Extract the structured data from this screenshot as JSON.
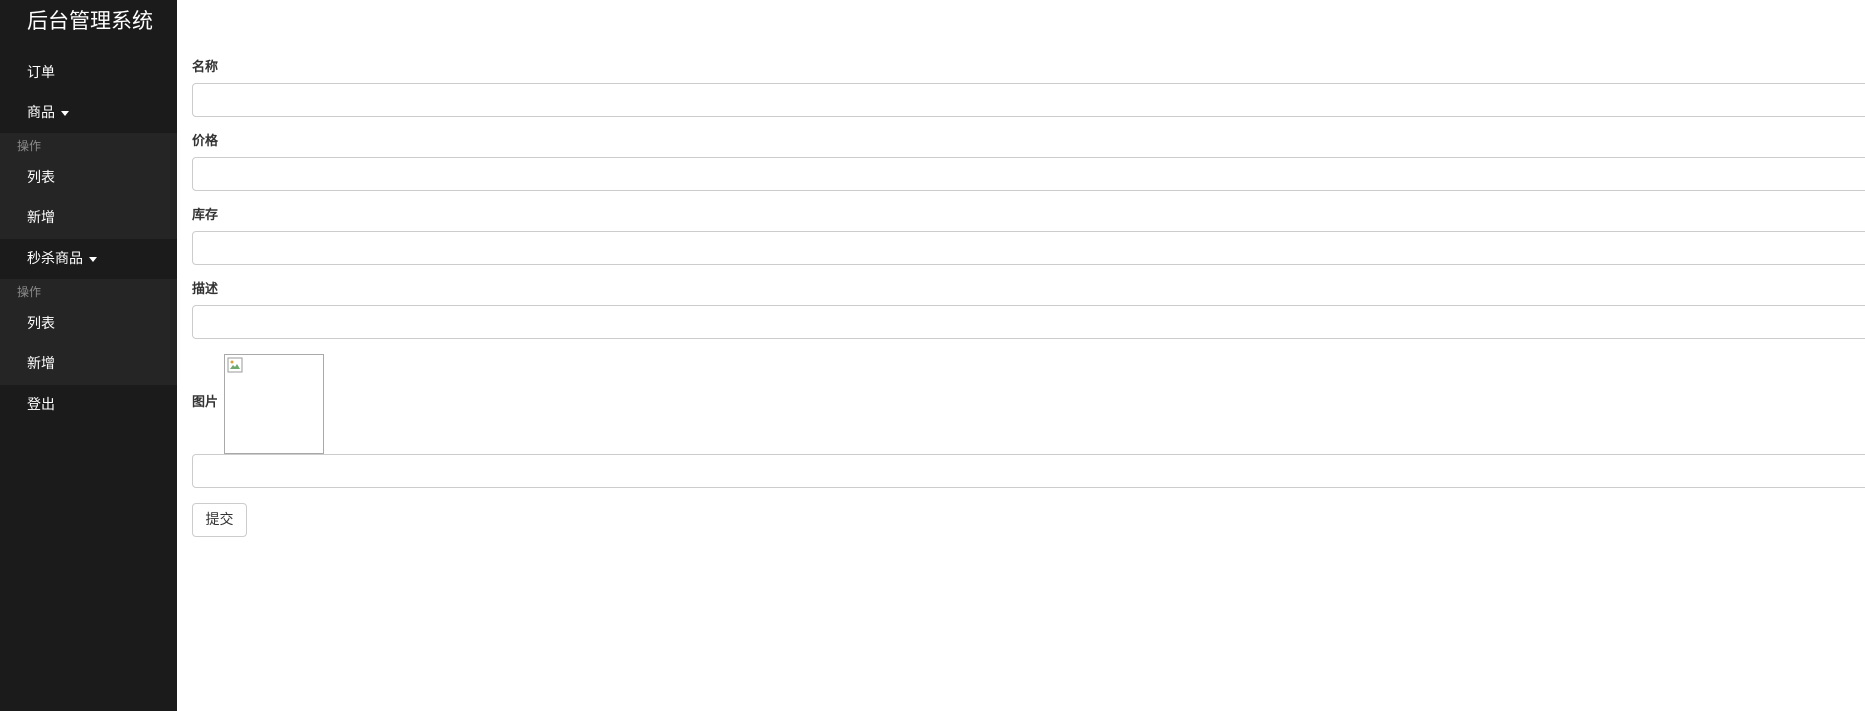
{
  "sidebar": {
    "brand": "后台管理系统",
    "nav": {
      "orders": "订单",
      "products": {
        "label": "商品",
        "header": "操作",
        "items": [
          "列表",
          "新增"
        ]
      },
      "seckill_products": {
        "label": "秒杀商品",
        "header": "操作",
        "items": [
          "列表",
          "新增"
        ]
      },
      "logout": "登出"
    }
  },
  "form": {
    "name": {
      "label": "名称",
      "value": ""
    },
    "price": {
      "label": "价格",
      "value": ""
    },
    "stock": {
      "label": "库存",
      "value": ""
    },
    "description": {
      "label": "描述",
      "value": ""
    },
    "image": {
      "label": "图片",
      "value": ""
    },
    "submit_label": "提交"
  },
  "icons": {
    "caret": "caret-down-icon",
    "broken_image": "broken-image-icon"
  },
  "colors": {
    "sidebar_bg": "#1b1b1b",
    "submenu_bg": "#252525",
    "submenu_header": "#8a8a8a",
    "input_border": "#cccccc"
  }
}
